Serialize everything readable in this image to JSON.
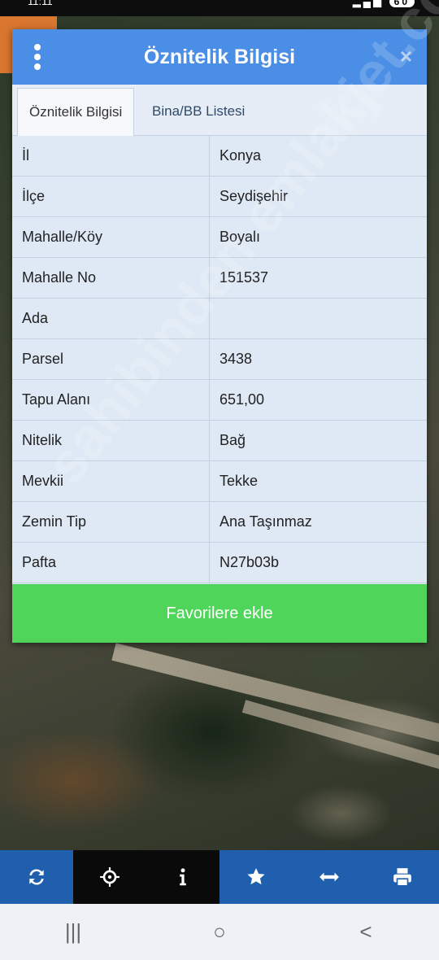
{
  "status_bar": {
    "time": "11:11",
    "battery": "60"
  },
  "dialog": {
    "title": "Öznitelik Bilgisi",
    "close_label": "×",
    "tabs": [
      {
        "label": "Öznitelik Bilgisi",
        "active": true
      },
      {
        "label": "Bina/BB Listesi",
        "active": false
      }
    ],
    "rows": [
      {
        "key": "İl",
        "value": "Konya"
      },
      {
        "key": "İlçe",
        "value": "Seydişehir"
      },
      {
        "key": "Mahalle/Köy",
        "value": "Boyalı"
      },
      {
        "key": "Mahalle No",
        "value": "151537"
      },
      {
        "key": "Ada",
        "value": ""
      },
      {
        "key": "Parsel",
        "value": "3438"
      },
      {
        "key": "Tapu Alanı",
        "value": "651,00"
      },
      {
        "key": "Nitelik",
        "value": "Bağ"
      },
      {
        "key": "Mevkii",
        "value": "Tekke"
      },
      {
        "key": "Zemin Tip",
        "value": "Ana Taşınmaz"
      },
      {
        "key": "Pafta",
        "value": "N27b03b"
      }
    ],
    "favorite_button": "Favorilere ekle"
  },
  "watermark": "sahibinden emlakjet.com",
  "toolbar": {
    "items": [
      {
        "icon": "refresh-icon"
      },
      {
        "icon": "crosshair-icon"
      },
      {
        "icon": "info-icon"
      },
      {
        "icon": "star-icon"
      },
      {
        "icon": "measure-icon"
      },
      {
        "icon": "print-icon"
      }
    ]
  },
  "navbar": {
    "recent": "|||",
    "home": "○",
    "back": "<"
  },
  "colors": {
    "header": "#4a8ee6",
    "favorite": "#4fd65a",
    "toolbar": "#1f5fae"
  }
}
